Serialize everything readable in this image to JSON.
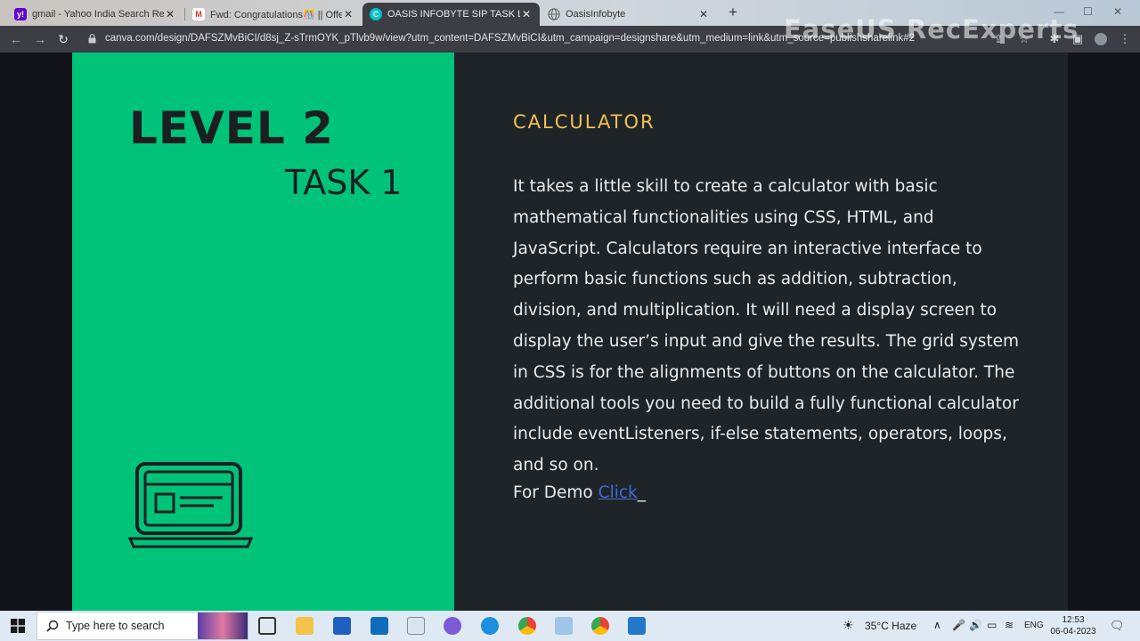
{
  "browser": {
    "tabs": [
      {
        "title": "gmail - Yahoo India Search Resu",
        "favicon": "yahoo-favicon",
        "color": "#6001d2"
      },
      {
        "title": "Fwd: Congratulations🎊 || Offer",
        "favicon": "gmail-favicon",
        "color": "#d93025"
      },
      {
        "title": "OASIS INFOBYTE SIP TASK LIST",
        "favicon": "canva-favicon",
        "color": "#00c4cc"
      },
      {
        "title": "OasisInfobyte",
        "favicon": "globe-favicon",
        "color": "#9aa0a6"
      }
    ],
    "active_tab": 2,
    "url": "canva.com/design/DAFSZMvBiCI/d8sj_Z-sTrmOYK_pTlvb9w/view?utm_content=DAFSZMvBiCI&utm_campaign=designshare&utm_medium=link&utm_source=publishsharelink#2",
    "watermark": "EaseUS RecExperts"
  },
  "slide": {
    "level": "LEVEL 2",
    "task": "TASK 1",
    "title": "CALCULATOR",
    "description": "It takes a little skill to create a calculator with basic mathematical functionalities using CSS, HTML, and JavaScript. Calculators require an interactive interface to perform basic functions such as addition, subtraction, division, and multiplication. It will need a  display screen to display the user’s input and give the results. The grid system in CSS is for the alignments of buttons on the calculator. The additional tools you need to build a fully functional calculator include eventListeners, if-else statements, operators, loops, and so on.",
    "demo_label": "For Demo",
    "demo_link": "Click",
    "colors": {
      "left_panel": "#00c37a",
      "right_panel": "#1f2428",
      "title": "#f2c14f",
      "link": "#3b6fd4"
    }
  },
  "taskbar": {
    "search_placeholder": "Type here to search",
    "weather": "35°C  Haze",
    "language": "ENG",
    "time": "12:53",
    "date": "06-04-2023"
  }
}
